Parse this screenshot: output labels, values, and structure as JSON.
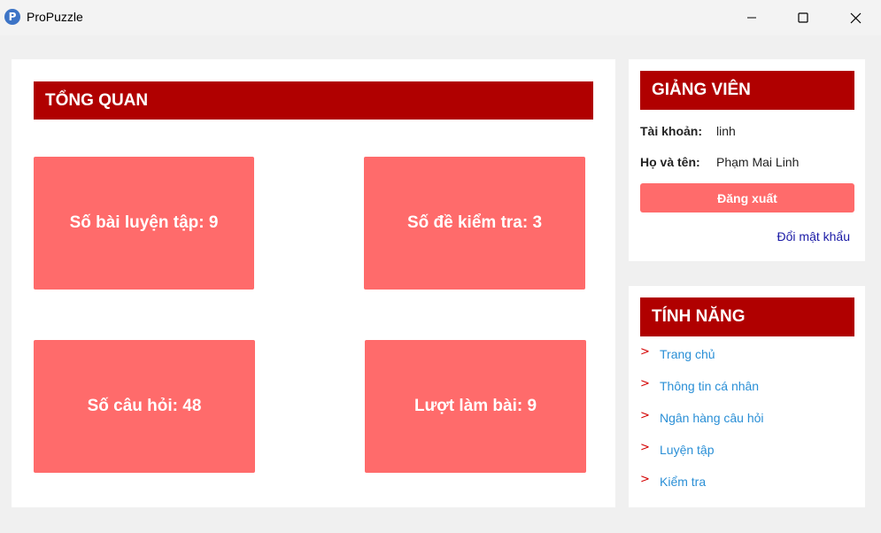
{
  "window": {
    "title": "ProPuzzle",
    "icon_letter": "P"
  },
  "overview": {
    "header": "TỔNG QUAN",
    "cards": [
      {
        "label": "Số bài luyện tập: 9"
      },
      {
        "label": "Số đề kiểm tra: 3"
      },
      {
        "label": "Số câu hỏi: 48"
      },
      {
        "label": "Lượt làm bài: 9"
      }
    ]
  },
  "user": {
    "header": "GIẢNG VIÊN",
    "account_label": "Tài khoản:",
    "account_value": "linh",
    "name_label": "Họ và tên:",
    "name_value": "Phạm Mai Linh",
    "logout_label": "Đăng xuất",
    "change_password": "Đổi mật khẩu"
  },
  "features": {
    "header": "TÍNH NĂNG",
    "items": [
      {
        "label": "Trang chủ"
      },
      {
        "label": "Thông tin cá nhân"
      },
      {
        "label": "Ngân hàng câu hỏi"
      },
      {
        "label": "Luyện tập"
      },
      {
        "label": "Kiểm tra"
      }
    ]
  },
  "colors": {
    "header_red": "#b00000",
    "card_red": "#ff6b6b",
    "link_blue": "#2a8fd6",
    "bullet_red": "#d40000"
  },
  "icons": {
    "app": "propuzzle-logo-icon",
    "minimize": "minimize-icon",
    "maximize": "maximize-icon",
    "close": "close-icon",
    "bullet": "chevron-right-icon"
  }
}
